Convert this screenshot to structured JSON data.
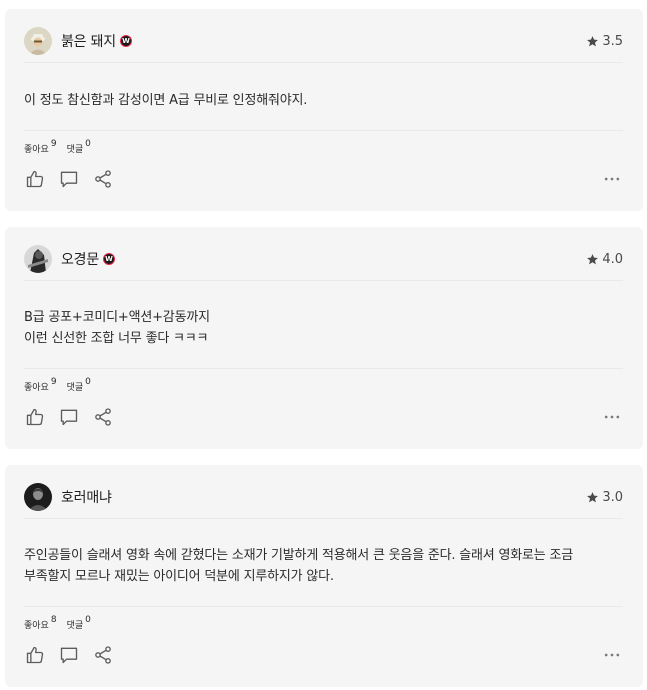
{
  "labels": {
    "likes": "좋아요",
    "replies": "댓글"
  },
  "reviews": [
    {
      "username": "붉은 돼지",
      "badge": "W",
      "has_badge": true,
      "rating": "3.5",
      "comment_lines": [
        "이 정도 참신함과 감성이면 A급 무비로 인정해줘야지."
      ],
      "likes": "9",
      "replies": "0"
    },
    {
      "username": "오경문",
      "badge": "W",
      "has_badge": true,
      "rating": "4.0",
      "comment_lines": [
        "B급 공포+코미디+액션+감동까지",
        "이런 신선한 조합 너무 좋다 ㅋㅋㅋ"
      ],
      "likes": "9",
      "replies": "0"
    },
    {
      "username": "호러매냐",
      "has_badge": false,
      "rating": "3.0",
      "comment_lines": [
        "주인공들이 슬래셔 영화 속에 갇혔다는 소재가 기발하게 적용해서 큰 웃음을 준다. 슬래셔 영화로는 조금",
        "부족할지 모르나 재밌는 아이디어 덕분에 지루하지가 않다."
      ],
      "likes": "8",
      "replies": "0"
    }
  ],
  "icons": {
    "like": "thumbs-up-icon",
    "comment": "comment-icon",
    "share": "share-icon",
    "more": "more-dots-icon",
    "star": "star-icon"
  },
  "colors": {
    "card_bg": "#f5f5f5",
    "badge_ring": "#e8284b",
    "icon": "#5c5c5c"
  }
}
